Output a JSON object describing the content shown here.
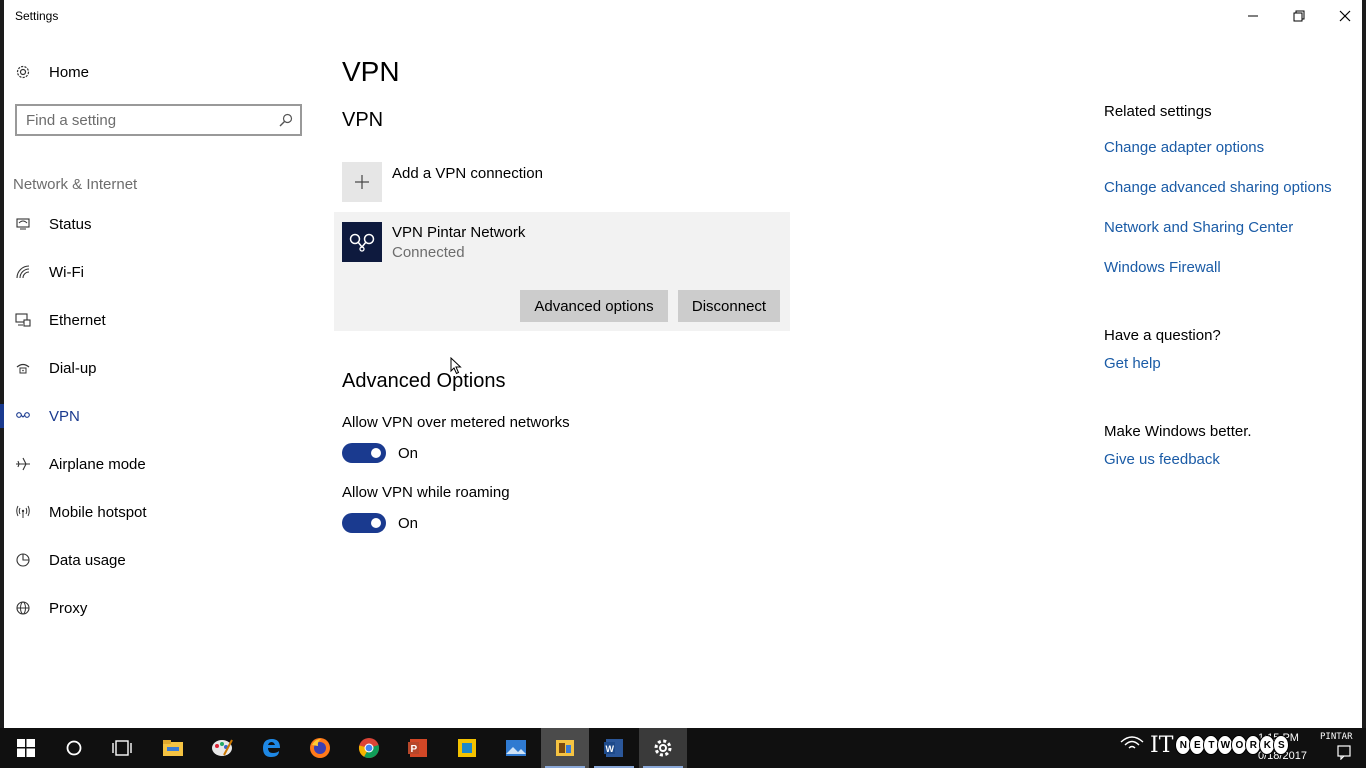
{
  "window": {
    "title": "Settings"
  },
  "sidebar": {
    "home_label": "Home",
    "search_placeholder": "Find a setting",
    "section_title": "Network & Internet",
    "items": [
      {
        "label": "Status",
        "icon": "globe-status-icon"
      },
      {
        "label": "Wi-Fi",
        "icon": "wifi-icon"
      },
      {
        "label": "Ethernet",
        "icon": "ethernet-icon"
      },
      {
        "label": "Dial-up",
        "icon": "dialup-icon"
      },
      {
        "label": "VPN",
        "icon": "vpn-icon",
        "active": true
      },
      {
        "label": "Airplane mode",
        "icon": "airplane-icon"
      },
      {
        "label": "Mobile hotspot",
        "icon": "hotspot-icon"
      },
      {
        "label": "Data usage",
        "icon": "data-usage-icon"
      },
      {
        "label": "Proxy",
        "icon": "globe-proxy-icon"
      }
    ]
  },
  "main": {
    "page_title": "VPN",
    "section_title": "VPN",
    "add_connection_label": "Add a VPN connection",
    "connection": {
      "name": "VPN Pintar Network",
      "status": "Connected",
      "advanced_button": "Advanced options",
      "disconnect_button": "Disconnect"
    },
    "advanced_title": "Advanced Options",
    "options": [
      {
        "label": "Allow VPN over metered networks",
        "state": "On",
        "on": true
      },
      {
        "label": "Allow VPN while roaming",
        "state": "On",
        "on": true
      }
    ]
  },
  "related": {
    "heading": "Related settings",
    "links": [
      "Change adapter options",
      "Change advanced sharing options",
      "Network and Sharing Center",
      "Windows Firewall"
    ],
    "question_heading": "Have a question?",
    "help_link": "Get help",
    "feedback_heading": "Make Windows better.",
    "feedback_link": "Give us feedback"
  },
  "taskbar": {
    "time": "1:15 PM",
    "date": "0/18/2017",
    "watermark_letters": [
      "N",
      "E",
      "T",
      "W",
      "O",
      "R",
      "K",
      "S"
    ],
    "watermark_prefix": "IT",
    "brand": "PINTAR"
  },
  "colors": {
    "accent": "#1a3a8f",
    "link": "#1a5ba6",
    "taskbar": "#101010"
  }
}
